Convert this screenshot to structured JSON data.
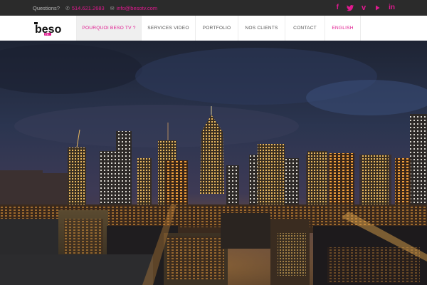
{
  "topbar": {
    "questions_label": "Questions?",
    "phone": "514.621.2683",
    "email": "info@besotv.com",
    "social_icons": [
      "facebook-icon",
      "twitter-icon",
      "vimeo-icon",
      "youtube-icon",
      "linkedin-icon"
    ]
  },
  "header": {
    "logo_text": "beso",
    "logo_subtext": "TV",
    "nav": {
      "pourquoi": "POURQUOI BESO TV ?",
      "services": "SERVICES VIDEO",
      "portfolio": "PORTFOLIO",
      "clients": "NOS CLIENTS",
      "contact": "CONTACT",
      "english": "ENGLISH"
    }
  },
  "colors": {
    "accent": "#e01a8f",
    "topbar_bg": "#2b2b2b",
    "nav_bg": "#ffffff",
    "nav_active_bg": "#efefef"
  }
}
